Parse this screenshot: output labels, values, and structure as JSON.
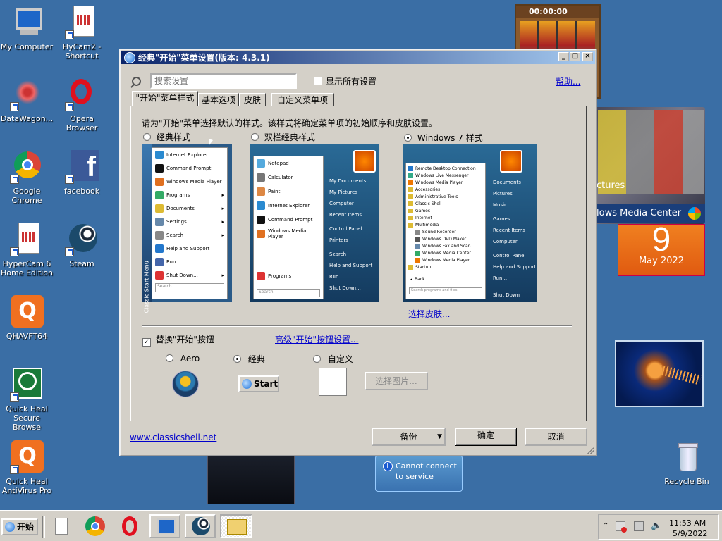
{
  "desktop_icons": [
    {
      "label": "My Computer"
    },
    {
      "label": "HyCam2 - Shortcut"
    },
    {
      "label": "DataWagon..."
    },
    {
      "label": "Opera Browser"
    },
    {
      "label": "Google Chrome"
    },
    {
      "label": "facebook"
    },
    {
      "label": "HyperCam 6 Home Edition"
    },
    {
      "label": "Steam"
    },
    {
      "label": "QHAVFT64"
    },
    {
      "label": "Quick Heal Secure Browse"
    },
    {
      "label": "Quick Heal AntiVirus Pro"
    },
    {
      "label": "Recycle Bin"
    }
  ],
  "gadgets": {
    "timer": "00:00:00",
    "slideshow_text_1": "ctures",
    "slideshow_text_2": "lows Media Center",
    "calendar_day": "9",
    "calendar_month": "May 2022",
    "weather_msg_1": "Cannot connect",
    "weather_msg_2": "to service"
  },
  "window": {
    "title": "经典\"开始\"菜单设置(版本: 4.3.1)",
    "search_placeholder": "搜索设置",
    "show_all_label": "显示所有设置",
    "help_link": "帮助...",
    "tabs": [
      "\"开始\"菜单样式",
      "基本选项",
      "皮肤",
      "自定义菜单项"
    ],
    "instruction": "请为\"开始\"菜单选择默认的样式。该样式将确定菜单项的初始顺序和皮肤设置。",
    "styles": [
      {
        "label": "经典样式",
        "selected": false
      },
      {
        "label": "双栏经典样式",
        "selected": false
      },
      {
        "label": "Windows 7 样式",
        "selected": true
      }
    ],
    "select_skin_link": "选择皮肤...",
    "replace_start_label": "替换\"开始\"按钮",
    "advanced_link": "高级\"开始\"按钮设置...",
    "button_options": [
      {
        "label": "Aero",
        "selected": false
      },
      {
        "label": "经典",
        "selected": true
      },
      {
        "label": "自定义",
        "selected": false
      }
    ],
    "start_label": "Start",
    "choose_image": "选择图片...",
    "website_link": "www.classicshell.net",
    "backup": "备份",
    "ok": "确定",
    "cancel": "取消"
  },
  "preview_classic": {
    "items": [
      "Internet Explorer",
      "Command Prompt",
      "Windows Media Player",
      "Programs",
      "Documents",
      "Settings",
      "Search",
      "Help and Support",
      "Run...",
      "Shut Down..."
    ],
    "side_text": "Classic Start Menu",
    "search": "Search"
  },
  "preview_two_col": {
    "left": [
      "Notepad",
      "Calculator",
      "Paint",
      "Internet Explorer",
      "Command Prompt",
      "Windows Media Player"
    ],
    "programs": "Programs",
    "right": [
      "My Documents",
      "My Pictures",
      "Computer",
      "Recent Items",
      "Control Panel",
      "Printers",
      "Search",
      "Help and Support",
      "Run...",
      "Shut Down..."
    ],
    "search": "Search"
  },
  "preview_w7": {
    "left": [
      "Remote Desktop Connection",
      "Windows Live Messenger",
      "Windows Media Player",
      "Accessories",
      "Administrative Tools",
      "Classic Shell",
      "Games",
      "Internet",
      "Multimedia",
      "Sound Recorder",
      "Windows DVD Maker",
      "Windows Fax and Scan",
      "Windows Media Center",
      "Windows Media Player",
      "Startup"
    ],
    "back": "Back",
    "search": "Search programs and files",
    "right": [
      "Documents",
      "Pictures",
      "Music",
      "Games",
      "Recent Items",
      "Computer",
      "Control Panel",
      "Help and Support",
      "Run..."
    ],
    "shutdown": "Shut Down"
  },
  "taskbar": {
    "start_label": "开始",
    "time": "11:53 AM",
    "date": "5/9/2022"
  }
}
